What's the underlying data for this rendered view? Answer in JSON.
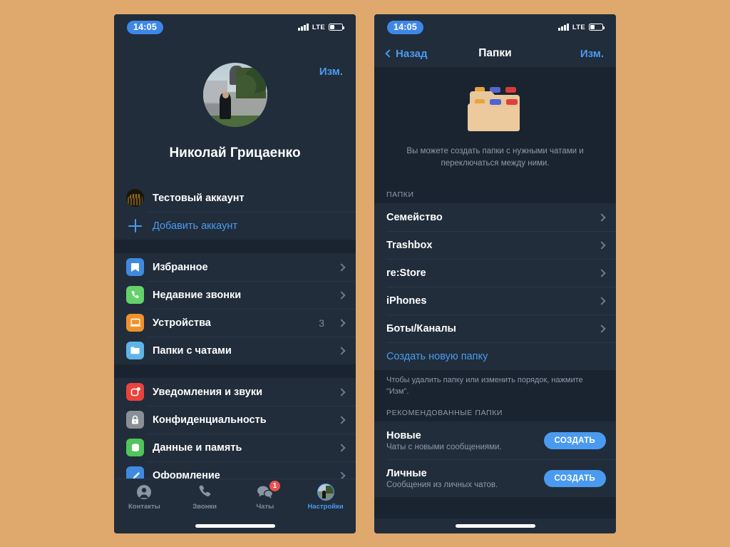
{
  "theme": {
    "page_background": "#dfa96e",
    "surface": "#212d3b",
    "surface_alt": "#1a2431",
    "accent": "#4a9bf0",
    "badge_red": "#e8534f",
    "secondary_text": "#8d9aa8"
  },
  "left_phone": {
    "status": {
      "time": "14:05",
      "network": "LTE",
      "signal_icon": "signal-bars-icon",
      "battery_icon": "battery-icon"
    },
    "header": {
      "edit_label": "Изм.",
      "avatar_icon": "profile-avatar",
      "name": "Николай Грицаенко"
    },
    "accounts": [
      {
        "label": "Тестовый аккаунт",
        "icon": "account-avatar",
        "type": "account"
      },
      {
        "label": "Добавить аккаунт",
        "icon": "plus-icon",
        "type": "add"
      }
    ],
    "group_primary": [
      {
        "label": "Избранное",
        "icon": "bookmark-icon",
        "color": "#3f8ae0",
        "value": ""
      },
      {
        "label": "Недавние звонки",
        "icon": "phone-icon",
        "color": "#63d26a",
        "value": ""
      },
      {
        "label": "Устройства",
        "icon": "laptop-icon",
        "color": "#f0922b",
        "value": "3"
      },
      {
        "label": "Папки с чатами",
        "icon": "folder-icon",
        "color": "#5fb4e8",
        "value": ""
      }
    ],
    "group_settings": [
      {
        "label": "Уведомления и звуки",
        "icon": "bell-icon",
        "color": "#e8433c",
        "value": ""
      },
      {
        "label": "Конфиденциальность",
        "icon": "lock-icon",
        "color": "#8a8f96",
        "value": ""
      },
      {
        "label": "Данные и память",
        "icon": "database-icon",
        "color": "#51c45a",
        "value": ""
      },
      {
        "label": "Оформление",
        "icon": "brush-icon",
        "color": "#3f8ae0",
        "value": ""
      }
    ],
    "tabs": [
      {
        "label": "Контакты",
        "icon": "contacts-icon",
        "active": false,
        "badge": ""
      },
      {
        "label": "Звонки",
        "icon": "calls-icon",
        "active": false,
        "badge": ""
      },
      {
        "label": "Чаты",
        "icon": "chats-icon",
        "active": false,
        "badge": "1"
      },
      {
        "label": "Настройки",
        "icon": "settings-avatar-icon",
        "active": true,
        "badge": ""
      }
    ]
  },
  "right_phone": {
    "status": {
      "time": "14:05",
      "network": "LTE",
      "signal_icon": "signal-bars-icon",
      "battery_icon": "battery-icon"
    },
    "navbar": {
      "back_label": "Назад",
      "title": "Папки",
      "edit_label": "Изм."
    },
    "hero": {
      "illustration_icon": "stacked-folders-illustration",
      "text": "Вы можете создать папки с нужными чатами и переключаться между ними."
    },
    "folders_section_header": "ПАПКИ",
    "folders": [
      {
        "label": "Семейство"
      },
      {
        "label": "Trashbox"
      },
      {
        "label": "re:Store"
      },
      {
        "label": "iPhones"
      },
      {
        "label": "Боты/Каналы"
      }
    ],
    "create_folder_label": "Создать новую папку",
    "footer_note": "Чтобы удалить папку или изменить порядок, нажмите \"Изм\".",
    "recommended_section_header": "РЕКОМЕНДОВАННЫЕ ПАПКИ",
    "recommended": [
      {
        "title": "Новые",
        "subtitle": "Чаты с новыми сообщениями.",
        "button": "СОЗДАТЬ"
      },
      {
        "title": "Личные",
        "subtitle": "Сообщения из личных чатов.",
        "button": "СОЗДАТЬ"
      }
    ]
  }
}
